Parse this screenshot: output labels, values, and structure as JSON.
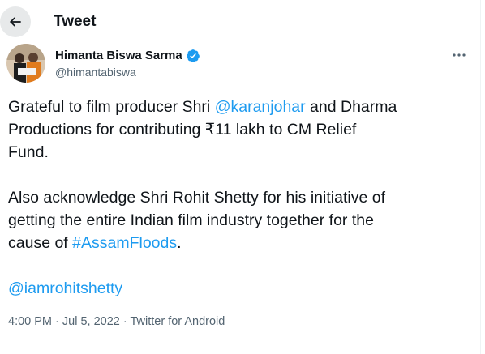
{
  "header": {
    "title": "Tweet"
  },
  "author": {
    "name": "Himanta Biswa Sarma",
    "handle": "@himantabiswa"
  },
  "tweet": {
    "line1_pre": "Grateful to film producer Shri ",
    "mention_karan": "@karanjohar",
    "line1_post": " and Dharma",
    "line2": "Productions for contributing ₹11 lakh to CM Relief",
    "line3": "Fund.",
    "para2_line1": "Also acknowledge Shri Rohit Shetty for his initiative of",
    "para2_line2": "getting the entire Indian film industry together for the",
    "para2_line3_pre": "cause of ",
    "hashtag": "#AssamFloods",
    "para2_line3_post": ".",
    "mention_rohit": "@iamrohitshetty"
  },
  "meta": {
    "time": "4:00 PM",
    "separator": " · ",
    "date": "Jul 5, 2022",
    "source": "Twitter for Android"
  },
  "colors": {
    "link": "#1d9bf0",
    "verified": "#1d9bf0",
    "text": "#0f1419",
    "muted": "#536471"
  },
  "icons": {
    "back": "arrow-left-icon",
    "verified": "verified-badge-icon",
    "more": "more-dots-icon"
  }
}
